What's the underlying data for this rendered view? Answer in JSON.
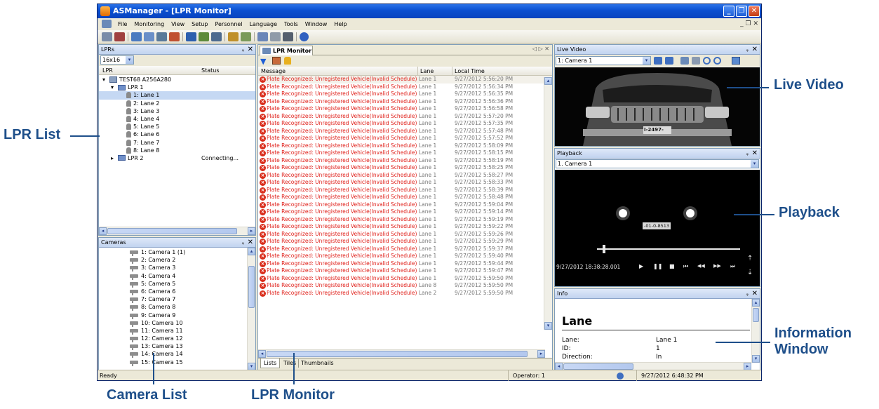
{
  "window": {
    "title": "ASManager - [LPR Monitor]",
    "minimize": "_",
    "restore": "❐",
    "close": "✕"
  },
  "menu": [
    "File",
    "Monitoring",
    "View",
    "Setup",
    "Personnel",
    "Language",
    "Tools",
    "Window",
    "Help"
  ],
  "mdi_controls": "_ ❐ ✕",
  "lprs_panel": {
    "title": "LPRs",
    "pin": "ᵩ",
    "close": "✕",
    "size_select": "16x16",
    "col_lpr": "LPR",
    "col_status": "Status",
    "tree": [
      {
        "label": "TEST68 A256A280",
        "level": 0,
        "kind": "pc",
        "expander": "▾",
        "status": ""
      },
      {
        "label": "LPR 1",
        "level": 1,
        "kind": "lpr",
        "expander": "▾",
        "status": ""
      },
      {
        "label": "1: Lane 1",
        "level": 2,
        "kind": "lane",
        "expander": "",
        "status": "",
        "selected": true
      },
      {
        "label": "2: Lane 2",
        "level": 2,
        "kind": "lane",
        "expander": "",
        "status": ""
      },
      {
        "label": "3: Lane 3",
        "level": 2,
        "kind": "lane",
        "expander": "",
        "status": ""
      },
      {
        "label": "4: Lane 4",
        "level": 2,
        "kind": "lane",
        "expander": "",
        "status": ""
      },
      {
        "label": "5: Lane 5",
        "level": 2,
        "kind": "lane",
        "expander": "",
        "status": ""
      },
      {
        "label": "6: Lane 6",
        "level": 2,
        "kind": "lane",
        "expander": "",
        "status": ""
      },
      {
        "label": "7: Lane 7",
        "level": 2,
        "kind": "lane",
        "expander": "",
        "status": ""
      },
      {
        "label": "8: Lane 8",
        "level": 2,
        "kind": "lane",
        "expander": "",
        "status": ""
      },
      {
        "label": "LPR 2",
        "level": 1,
        "kind": "lpr",
        "expander": "▸",
        "status": "Connecting..."
      }
    ]
  },
  "cameras_panel": {
    "title": "Cameras",
    "pin": "ᵩ",
    "close": "✕",
    "items": [
      "1: Camera 1 (1)",
      "2: Camera 2",
      "3: Camera 3",
      "4: Camera 4",
      "5: Camera 5",
      "6: Camera 6",
      "7: Camera 7",
      "8: Camera 8",
      "9: Camera 9",
      "10: Camera 10",
      "11: Camera 11",
      "12: Camera 12",
      "13: Camera 13",
      "14: Camera 14",
      "15: Camera 15"
    ]
  },
  "monitor": {
    "tab": "LPR Monitor",
    "tab_nav": "◁ ▷ ✕",
    "col_message": "Message",
    "col_lane": "Lane",
    "col_time": "Local Time",
    "message_text": "Plate Recognized: Unregistered Vehicle(Invalid Schedule)",
    "rows": [
      {
        "lane": "Lane 1",
        "time": "9/27/2012 5:56:20 PM"
      },
      {
        "lane": "Lane 1",
        "time": "9/27/2012 5:56:34 PM"
      },
      {
        "lane": "Lane 1",
        "time": "9/27/2012 5:56:35 PM"
      },
      {
        "lane": "Lane 1",
        "time": "9/27/2012 5:56:36 PM"
      },
      {
        "lane": "Lane 1",
        "time": "9/27/2012 5:56:58 PM"
      },
      {
        "lane": "Lane 1",
        "time": "9/27/2012 5:57:20 PM"
      },
      {
        "lane": "Lane 1",
        "time": "9/27/2012 5:57:35 PM"
      },
      {
        "lane": "Lane 1",
        "time": "9/27/2012 5:57:48 PM"
      },
      {
        "lane": "Lane 1",
        "time": "9/27/2012 5:57:52 PM"
      },
      {
        "lane": "Lane 1",
        "time": "9/27/2012 5:58:09 PM"
      },
      {
        "lane": "Lane 1",
        "time": "9/27/2012 5:58:15 PM"
      },
      {
        "lane": "Lane 1",
        "time": "9/27/2012 5:58:19 PM"
      },
      {
        "lane": "Lane 1",
        "time": "9/27/2012 5:58:25 PM"
      },
      {
        "lane": "Lane 1",
        "time": "9/27/2012 5:58:27 PM"
      },
      {
        "lane": "Lane 1",
        "time": "9/27/2012 5:58:33 PM"
      },
      {
        "lane": "Lane 1",
        "time": "9/27/2012 5:58:39 PM"
      },
      {
        "lane": "Lane 1",
        "time": "9/27/2012 5:58:48 PM"
      },
      {
        "lane": "Lane 1",
        "time": "9/27/2012 5:59:04 PM"
      },
      {
        "lane": "Lane 1",
        "time": "9/27/2012 5:59:14 PM"
      },
      {
        "lane": "Lane 1",
        "time": "9/27/2012 5:59:19 PM"
      },
      {
        "lane": "Lane 1",
        "time": "9/27/2012 5:59:22 PM"
      },
      {
        "lane": "Lane 1",
        "time": "9/27/2012 5:59:26 PM"
      },
      {
        "lane": "Lane 1",
        "time": "9/27/2012 5:59:29 PM"
      },
      {
        "lane": "Lane 1",
        "time": "9/27/2012 5:59:37 PM"
      },
      {
        "lane": "Lane 1",
        "time": "9/27/2012 5:59:40 PM"
      },
      {
        "lane": "Lane 1",
        "time": "9/27/2012 5:59:44 PM"
      },
      {
        "lane": "Lane 1",
        "time": "9/27/2012 5:59:47 PM"
      },
      {
        "lane": "Lane 1",
        "time": "9/27/2012 5:59:50 PM"
      },
      {
        "lane": "Lane 8",
        "time": "9/27/2012 5:59:50 PM"
      },
      {
        "lane": "Lane 2",
        "time": "9/27/2012 5:59:50 PM"
      }
    ],
    "view_tabs": [
      "Lists",
      "Tiles",
      "Thumbnails"
    ]
  },
  "live_video": {
    "title": "Live Video",
    "pin": "ᵩ",
    "close": "✕",
    "camera_select": "1: Camera 1",
    "plate_text": "I-2497-"
  },
  "playback": {
    "title": "Playback",
    "pin": "ᵩ",
    "close": "✕",
    "camera_select": "1. Camera 1",
    "plate_text": "-01-0-8513",
    "timestamp": "9/27/2012 18:38:28.001",
    "position_fraction": 0.05,
    "controls": [
      "▶",
      "❚❚",
      "■",
      "⏮",
      "◀◀",
      "▶▶",
      "⏭"
    ],
    "speed_up": "⇡",
    "speed_down": "⇣"
  },
  "info": {
    "title": "Info",
    "pin": "ᵩ",
    "close": "✕",
    "heading": "Lane",
    "fields": [
      {
        "label": "Lane:",
        "value": "Lane 1"
      },
      {
        "label": "ID:",
        "value": "1"
      },
      {
        "label": "Direction:",
        "value": "In"
      }
    ]
  },
  "statusbar": {
    "ready": "Ready",
    "operator": "Operator: 1",
    "datetime": "9/27/2012 6:48:32 PM"
  },
  "callouts": {
    "lpr_list": "LPR List",
    "camera_list": "Camera List",
    "lpr_monitor": "LPR Monitor",
    "live_video": "Live Video",
    "playback": "Playback",
    "information_line1": "Information",
    "information_line2": "Window"
  },
  "colors": {
    "title_blue": "#0a4fd0",
    "error_red": "#e0211b",
    "callout_blue": "#1e4f8a",
    "panel_header": "#c1d3ef"
  }
}
